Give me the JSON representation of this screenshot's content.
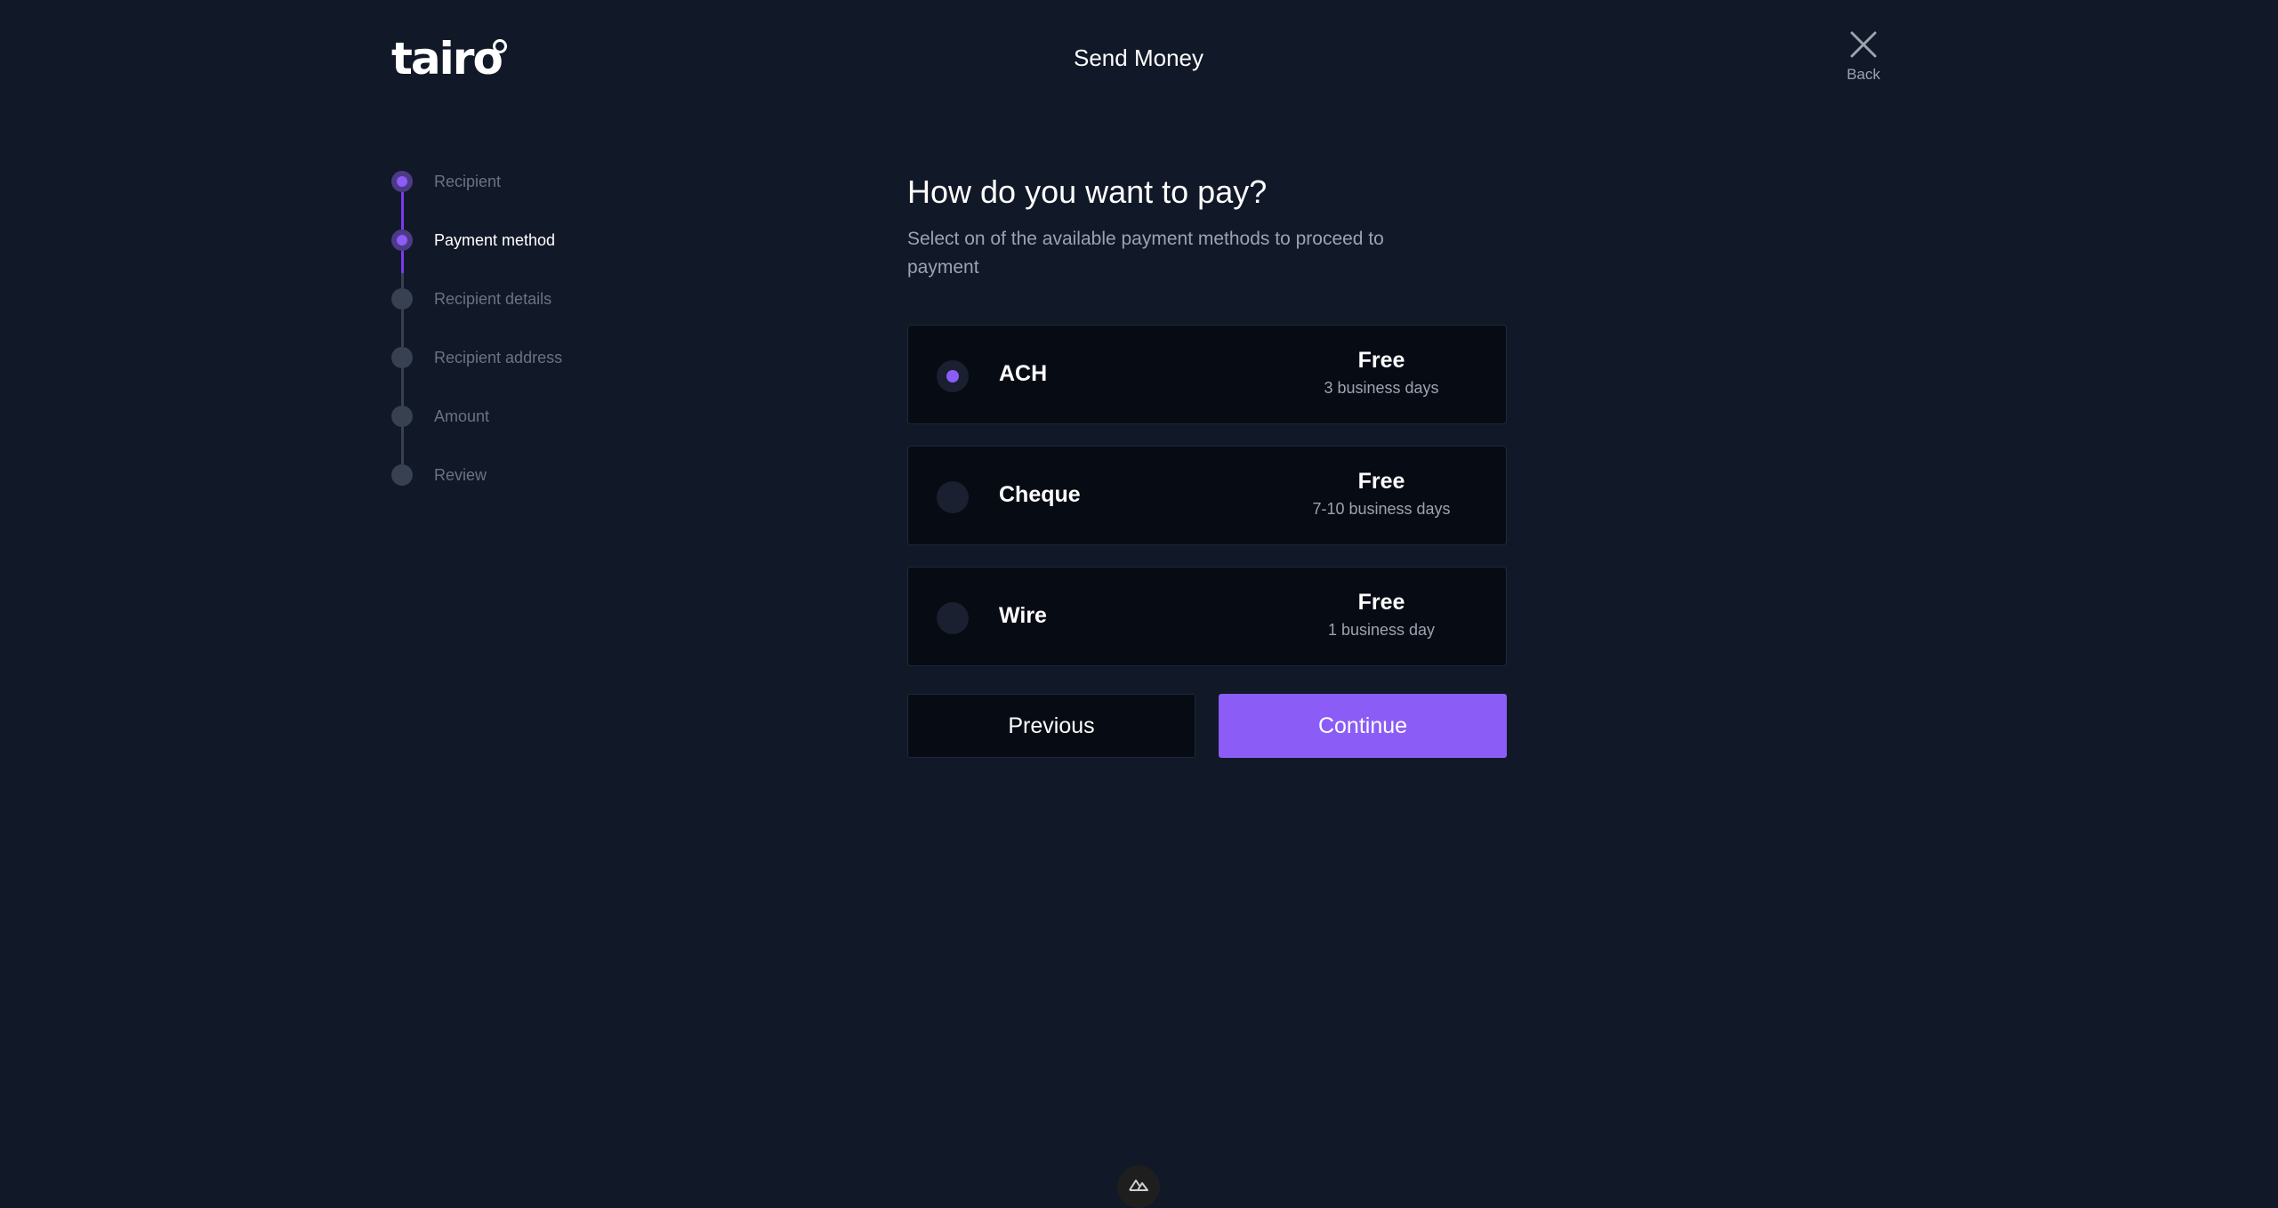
{
  "header": {
    "logo_text": "tairo",
    "title": "Send Money",
    "back_label": "Back"
  },
  "steps": [
    {
      "label": "Recipient",
      "state": "done"
    },
    {
      "label": "Payment method",
      "state": "active"
    },
    {
      "label": "Recipient details",
      "state": "pending"
    },
    {
      "label": "Recipient address",
      "state": "pending"
    },
    {
      "label": "Amount",
      "state": "pending"
    },
    {
      "label": "Review",
      "state": "pending"
    }
  ],
  "main": {
    "heading": "How do you want to pay?",
    "subtitle": "Select on of the available payment methods to proceed to payment"
  },
  "options": [
    {
      "name": "ACH",
      "fee": "Free",
      "time": "3 business days",
      "selected": true
    },
    {
      "name": "Cheque",
      "fee": "Free",
      "time": "7-10 business days",
      "selected": false
    },
    {
      "name": "Wire",
      "fee": "Free",
      "time": "1 business day",
      "selected": false
    }
  ],
  "buttons": {
    "previous": "Previous",
    "continue": "Continue"
  },
  "colors": {
    "background": "#111827",
    "accent": "#8b5cf6",
    "card": "#070b14"
  }
}
